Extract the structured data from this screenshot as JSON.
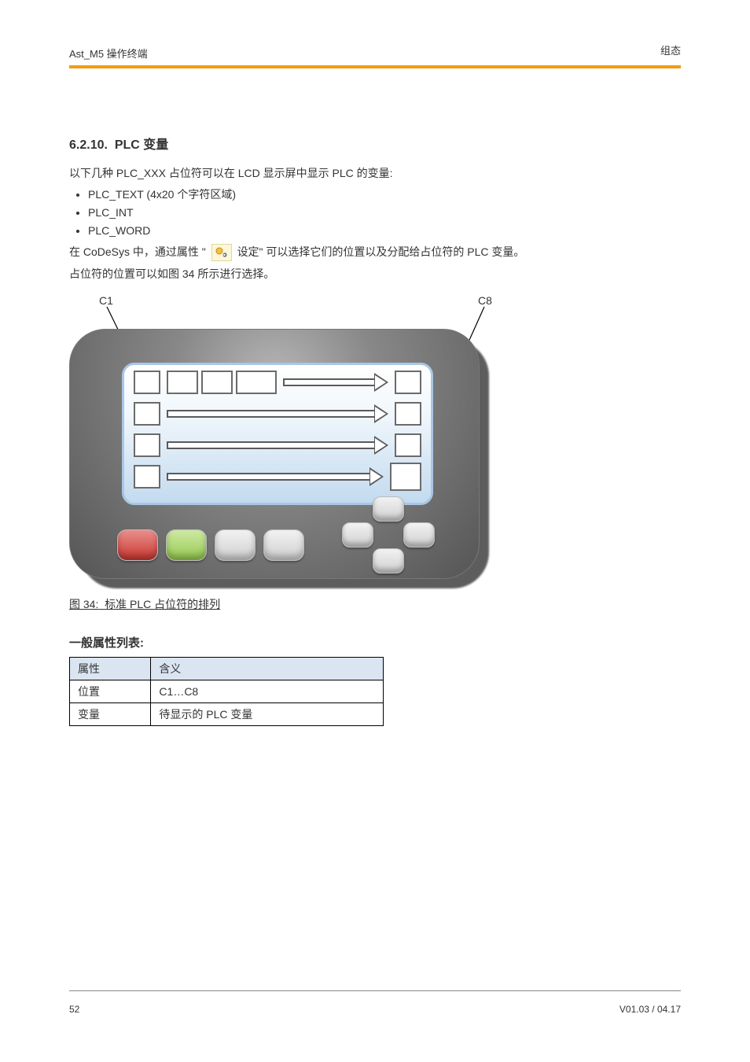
{
  "header": {
    "left": "Ast_M5 操作终端",
    "right": "组态"
  },
  "section": {
    "number": "6.2.10.",
    "title": "PLC 变量"
  },
  "intro": "以下几种 PLC_XXX 占位符可以在 LCD 显示屏中显示 PLC 的变量:",
  "bullets": [
    "PLC_TEXT (4x20 个字符区域)",
    "PLC_INT",
    "PLC_WORD"
  ],
  "para_icon_pre": "在 CoDeSys 中，通过属性 \"",
  "para_icon_post": " 设定\" 可以选择它们的位置以及分配给占位符的 PLC 变量。",
  "after_icon": "占位符的位置可以如图 34 所示进行选择。",
  "callouts": {
    "c1": "C1",
    "c8": "C8"
  },
  "fig": {
    "num": "图 34:",
    "cap": "标准 PLC 占位符的排列"
  },
  "list_header": "一般属性列表:",
  "table": {
    "h1": "属性",
    "h2": "含义",
    "r1a": "位置",
    "r1b": "C1…C8",
    "r2a": "变量",
    "r2b": "待显示的 PLC 变量"
  },
  "footer": {
    "left": "52",
    "right": "V01.03 / 04.17"
  }
}
